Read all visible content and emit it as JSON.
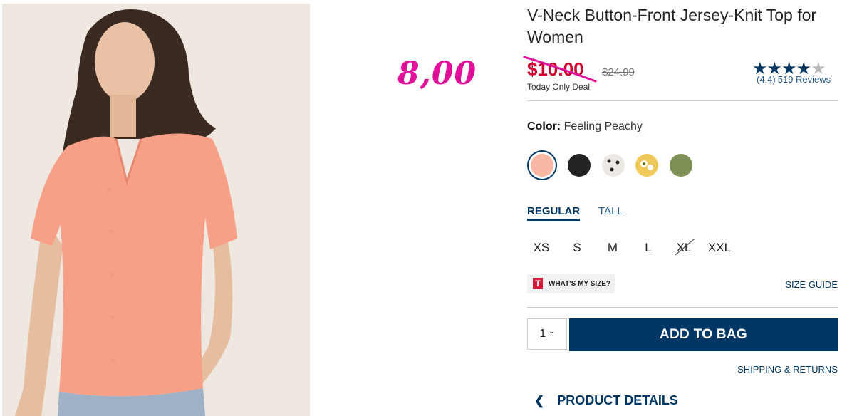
{
  "overlay": {
    "handwritten_price": "8,00"
  },
  "product": {
    "title": "V-Neck Button-Front Jersey-Knit Top for Women",
    "sale_price": "$10.00",
    "original_price": "$24.99",
    "deal_label": "Today Only Deal",
    "rating": 4.4,
    "rating_text": "(4.4)",
    "reviews_text": "519 Reviews"
  },
  "color": {
    "label": "Color:",
    "selected_name": "Feeling Peachy",
    "swatches": [
      {
        "name": "Feeling Peachy",
        "hex": "#f8b8a4",
        "selected": true
      },
      {
        "name": "Black",
        "hex": "#222222"
      },
      {
        "name": "Polka Dot",
        "hex": "#ece9e4"
      },
      {
        "name": "Floral Yellow",
        "hex": "#efc95a"
      },
      {
        "name": "Olive",
        "hex": "#7f9156"
      }
    ]
  },
  "fit_tabs": [
    {
      "label": "REGULAR",
      "active": true
    },
    {
      "label": "TALL",
      "active": false
    }
  ],
  "sizes": [
    {
      "label": "XS"
    },
    {
      "label": "S"
    },
    {
      "label": "M"
    },
    {
      "label": "L"
    },
    {
      "label": "XL",
      "unavailable": true
    },
    {
      "label": "XXL"
    }
  ],
  "size_help": {
    "logo_letter": "T",
    "whats_my_size": "WHAT'S MY SIZE?",
    "size_guide": "SIZE GUIDE"
  },
  "purchase": {
    "quantity": "1",
    "add_to_bag": "ADD TO BAG",
    "shipping_returns": "SHIPPING & RETURNS",
    "product_details": "PRODUCT DETAILS"
  },
  "colors": {
    "brand_navy": "#003764",
    "sale_red": "#d0002e",
    "marker_pink": "#e0109a"
  }
}
